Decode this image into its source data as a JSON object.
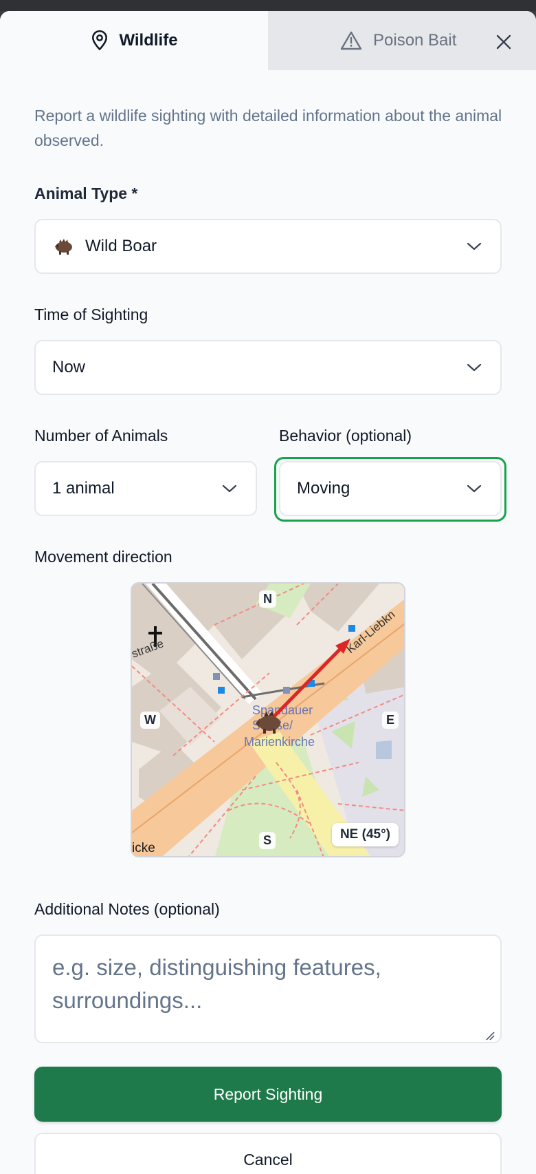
{
  "tabs": {
    "wildlife": "Wildlife",
    "poison_bait": "Poison Bait"
  },
  "intro": "Report a wildlife sighting with detailed information about the animal observed.",
  "animal_type": {
    "label": "Animal Type *",
    "value": "Wild Boar",
    "icon": "boar-icon"
  },
  "time_of_sighting": {
    "label": "Time of Sighting",
    "value": "Now"
  },
  "number_of_animals": {
    "label": "Number of Animals",
    "value": "1 animal"
  },
  "behavior": {
    "label": "Behavior (optional)",
    "value": "Moving"
  },
  "movement": {
    "label": "Movement direction",
    "compass": {
      "n": "N",
      "s": "S",
      "e": "E",
      "w": "W"
    },
    "heading": "NE (45°)",
    "map_labels": {
      "street_left": "straße",
      "street_right": "Karl-Liebkn",
      "stop_line1": "Spandauer",
      "stop_line2": "Straße/",
      "stop_line3": "Marienkirche",
      "bottom_left": "icke"
    }
  },
  "notes": {
    "label": "Additional Notes (optional)",
    "placeholder": "e.g. size, distinguishing features, surroundings..."
  },
  "actions": {
    "submit": "Report Sighting",
    "cancel": "Cancel"
  },
  "colors": {
    "primary": "#1e7a4a",
    "focus_border": "#16a34a",
    "arrow": "#dc2626"
  }
}
